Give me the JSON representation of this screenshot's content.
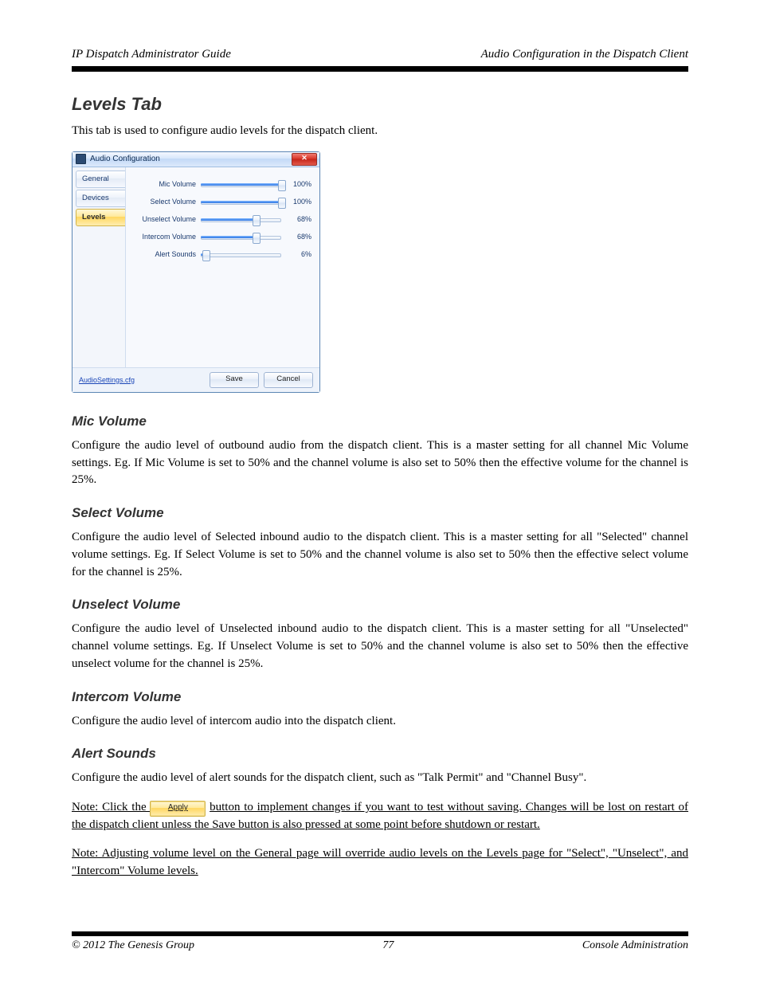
{
  "header": {
    "left": "IP Dispatch Administrator Guide",
    "right": "Audio Configuration in the  Dispatch Client"
  },
  "section": {
    "title": "Levels Tab",
    "subtitle": "This tab is used to configure audio levels for the dispatch client."
  },
  "dialog": {
    "title": "Audio Configuration",
    "tabs": [
      "General",
      "Devices",
      "Levels"
    ],
    "activeTab": 2,
    "sliders": [
      {
        "label": "Mic Volume",
        "value": 100,
        "text": "100%"
      },
      {
        "label": "Select Volume",
        "value": 100,
        "text": "100%"
      },
      {
        "label": "Unselect Volume",
        "value": 68,
        "text": "68%"
      },
      {
        "label": "Intercom Volume",
        "value": 68,
        "text": "68%"
      },
      {
        "label": "Alert Sounds",
        "value": 6,
        "text": "6%"
      }
    ],
    "link": "AudioSettings.cfg",
    "save": "Save",
    "cancel": "Cancel"
  },
  "fields": {
    "mic": {
      "h": "Mic Volume",
      "d": "Configure the audio level of outbound audio from the dispatch client.  This is a master setting for all  channel Mic Volume settings.  Eg. If Mic Volume  is  set  to 50% and  the  channel volume  is  also  set  to 50% then the effective volume for the channel is 25%."
    },
    "sel": {
      "h": "Select Volume",
      "d": "Configure the audio level of Selected inbound audio to the dispatch client.  This is a master setting for all \"Selected\" channel volume settings.  Eg. If Select Volume is set to 50% and the channel volume is also set to 50% then the effective select volume for the channel is 25%."
    },
    "uns": {
      "h": "Unselect Volume",
      "d": "Configure the audio level of Unselected inbound audio to the dispatch client.  This is a master setting for all \"Unselected\" channel volume settings.  Eg. If Unselect Volume is set to 50% and the channel volume is also set to 50% then the effective unselect volume for the channel is 25%."
    },
    "int": {
      "h": "Intercom Volume",
      "d": "Configure the audio level of intercom audio into the dispatch client."
    },
    "alert": {
      "h": "Alert Sounds",
      "d": "Configure the audio level of alert sounds for the dispatch client, such as \"Talk  Permit\" and \"Channel Busy\"."
    }
  },
  "apply": {
    "label": "Apply",
    "note_before": "Note: Click the ",
    "note_after": " button to implement changes if you want to test without saving. Changes will be lost on restart of the dispatch client unless the Save button is also pressed at some point before shutdown or restart.",
    "extra": "Note: Adjusting volume level on the General page will override audio levels on the Levels page for \"Select\", \"Unselect\", and \"Intercom\" Volume levels."
  },
  "footer": {
    "left": "© 2012 The Genesis Group",
    "center": "77",
    "right": "Console Administration"
  }
}
